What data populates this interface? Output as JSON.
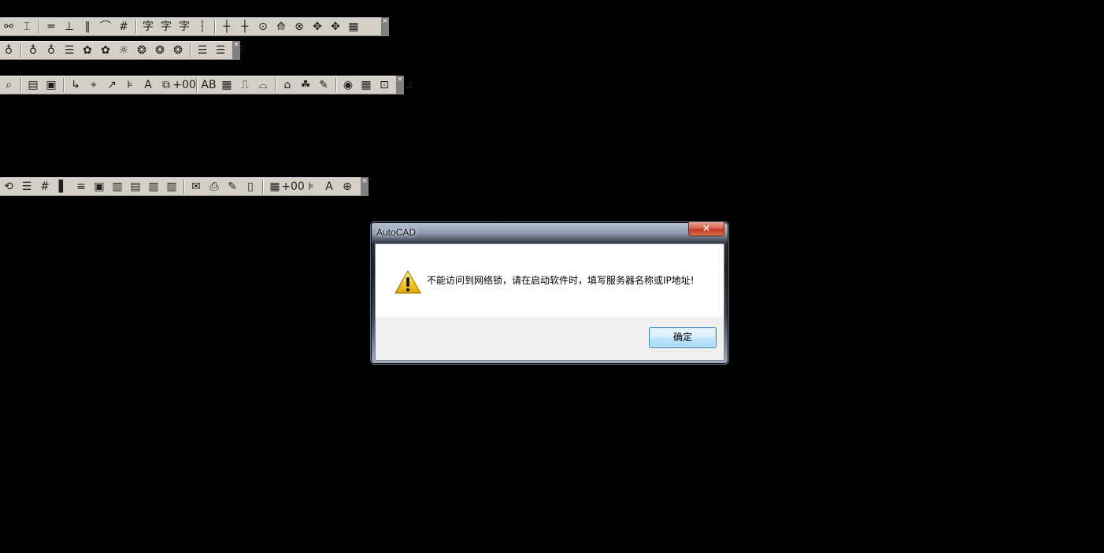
{
  "toolbars": [
    {
      "name": "toolbar-1",
      "icons": [
        "⚯",
        "⌶",
        "═",
        "⊥",
        "‖",
        "⌒",
        "#",
        "字",
        "字",
        "字",
        "┆",
        "┼",
        "┼",
        "⊙",
        "⟰",
        "⊗",
        "✥",
        "✥",
        "▦"
      ]
    },
    {
      "name": "toolbar-2",
      "icons": [
        "♁",
        "♁",
        "♁",
        "☰",
        "✿",
        "✿",
        "☼",
        "❂",
        "❂",
        "❂",
        "☰",
        "☰",
        "☰"
      ]
    },
    {
      "name": "toolbar-3",
      "icons": [
        "⌕",
        "▤",
        "▣",
        "↳",
        "⌖",
        "↗",
        "⊧",
        "A",
        "⧉",
        "+00",
        "AB",
        "▦",
        "⎍",
        "⌓",
        "⌂",
        "☘",
        "✎",
        "◉",
        "▦",
        "⊡",
        "⊿"
      ]
    },
    {
      "name": "toolbar-4",
      "icons": [
        "⟲",
        "☰",
        "#",
        "▌",
        "≡",
        "▣",
        "▥",
        "▤",
        "▥",
        "▥",
        "✉",
        "⎙",
        "✎",
        "▯",
        "▦",
        "+00",
        "⊧",
        "A",
        "⊕",
        "☯"
      ]
    }
  ],
  "dialog": {
    "title": "AutoCAD",
    "close_glyph": "✕",
    "message": "不能访问到网络锁，请在启动软件时，填写服务器名称或IP地址!",
    "ok_label": "确定",
    "icon": "warning-icon"
  }
}
